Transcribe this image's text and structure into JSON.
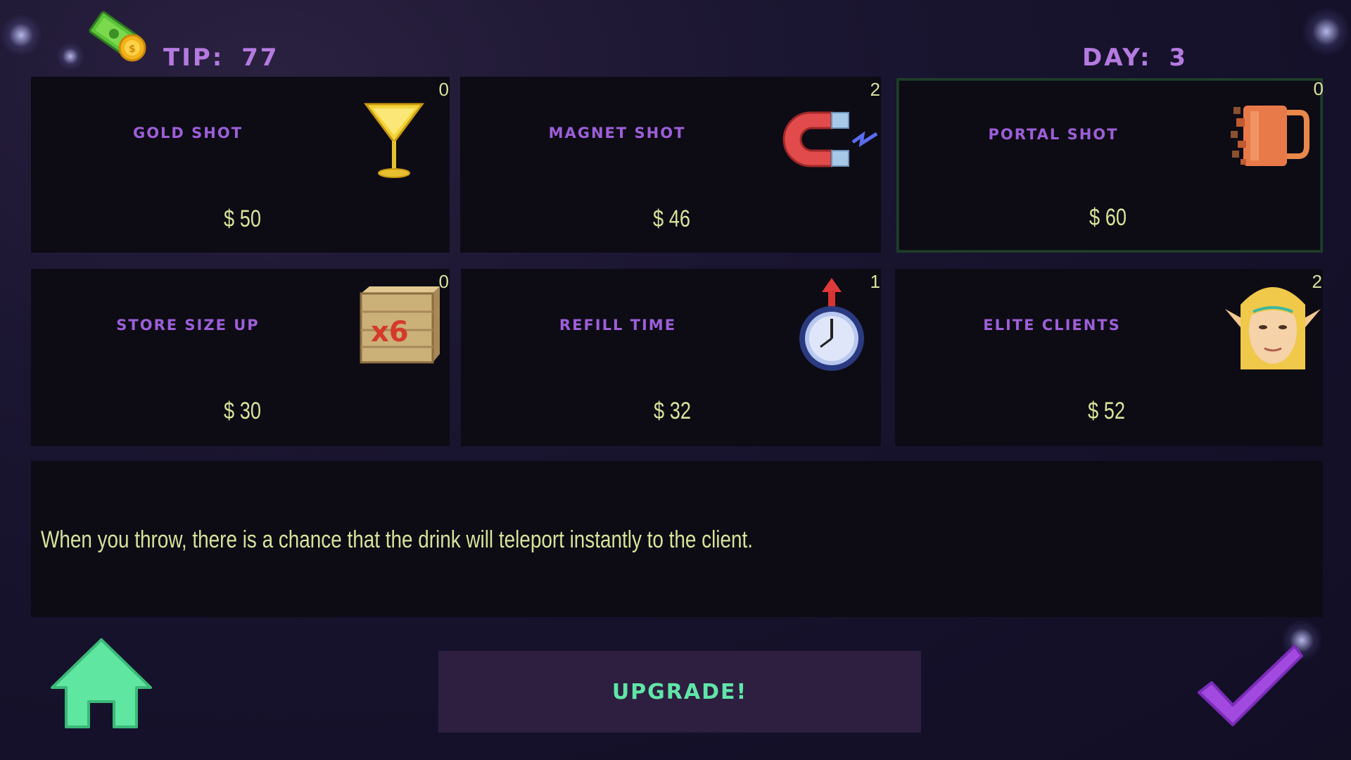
{
  "header": {
    "tip_label": "TIP:",
    "tip_value": "77",
    "day_label": "DAY:",
    "day_value": "3"
  },
  "upgrades": [
    {
      "name": "GOLD SHOT",
      "price": "$ 50",
      "count": "0",
      "icon": "martini-glass-icon"
    },
    {
      "name": "MAGNET SHOT",
      "price": "$ 46",
      "count": "2",
      "icon": "magnet-icon"
    },
    {
      "name": "PORTAL SHOT",
      "price": "$ 60",
      "count": "0",
      "icon": "beer-mug-icon",
      "selected": true
    },
    {
      "name": "STORE SIZE UP",
      "price": "$ 30",
      "count": "0",
      "icon": "crate-x6-icon",
      "badge": "x6"
    },
    {
      "name": "REFILL TIME",
      "price": "$ 32",
      "count": "1",
      "icon": "stopwatch-icon"
    },
    {
      "name": "ELITE CLIENTS",
      "price": "$ 52",
      "count": "2",
      "icon": "elf-face-icon"
    }
  ],
  "description": "When you throw, there is a chance that the drink will teleport instantly to the client.",
  "buttons": {
    "upgrade_label": "UPGRADE!",
    "home_icon": "home-icon",
    "confirm_icon": "checkmark-icon"
  },
  "colors": {
    "title_purple": "#b57ae0",
    "price_yellow": "#d7e39a",
    "upgrade_green": "#5fe6a8",
    "home_green": "#5fe6a0",
    "check_purple": "#a24ae0"
  }
}
